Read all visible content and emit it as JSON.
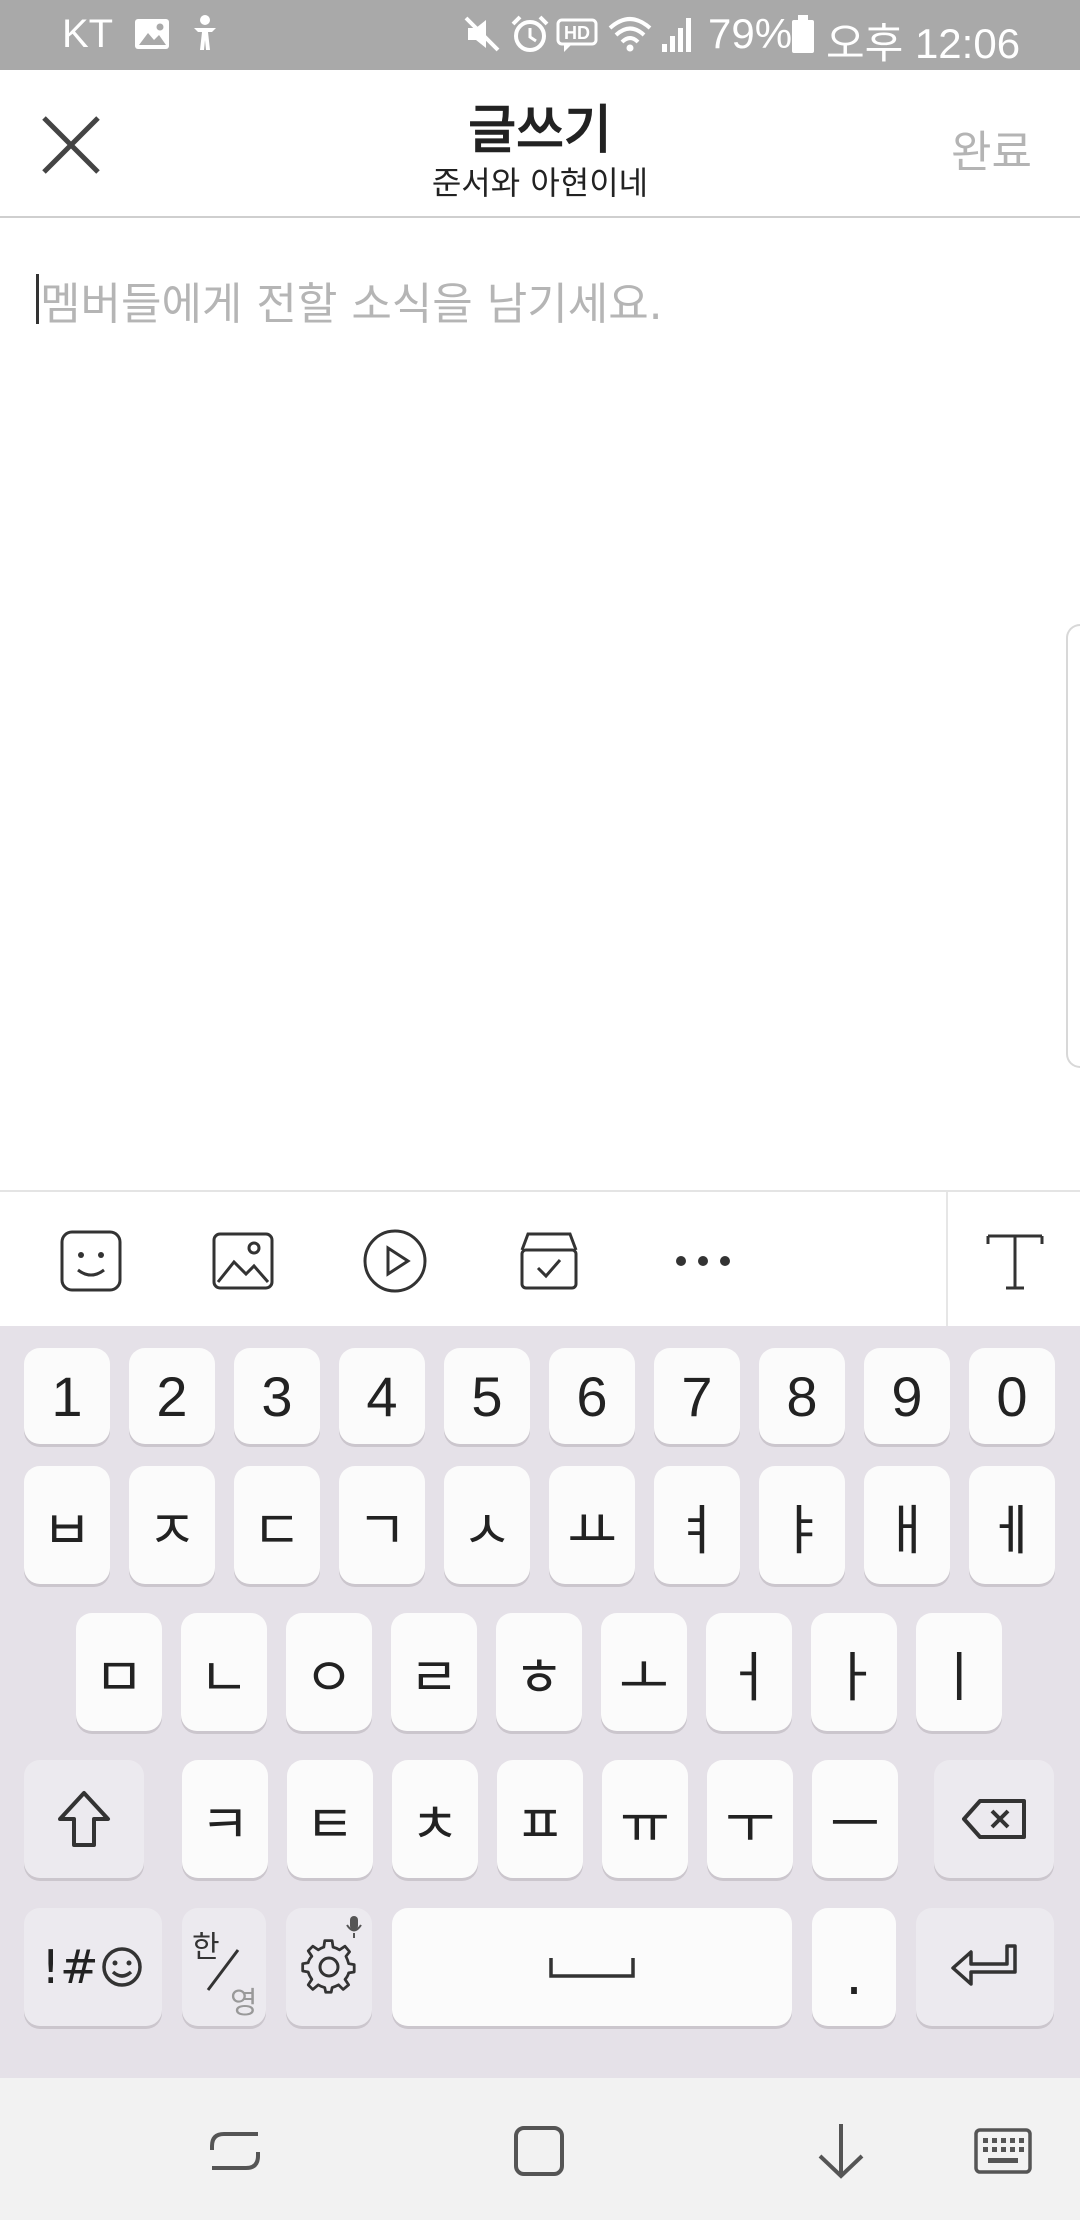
{
  "status_bar": {
    "carrier": "KT",
    "battery": "79%",
    "time": "오후 12:06",
    "icons": [
      "gallery-notification-icon",
      "accessibility-icon",
      "mute-icon",
      "alarm-icon",
      "hd-voice-icon",
      "wifi-icon",
      "signal-icon",
      "battery-icon"
    ]
  },
  "header": {
    "title": "글쓰기",
    "subtitle": "준서와 아현이네",
    "done_label": "완료",
    "close_icon": "close-icon"
  },
  "editor": {
    "placeholder": "멤버들에게 전할 소식을 남기세요."
  },
  "toolbar": {
    "icons": [
      "sticker-icon",
      "photo-icon",
      "video-icon",
      "vote-icon",
      "more-icon",
      "text-style-icon"
    ]
  },
  "keyboard": {
    "number_row": [
      "1",
      "2",
      "3",
      "4",
      "5",
      "6",
      "7",
      "8",
      "9",
      "0"
    ],
    "row1": [
      "ㅂ",
      "ㅈ",
      "ㄷ",
      "ㄱ",
      "ㅅ",
      "ㅛ",
      "ㅕ",
      "ㅑ",
      "ㅐ",
      "ㅔ"
    ],
    "row2": [
      "ㅁ",
      "ㄴ",
      "ㅇ",
      "ㄹ",
      "ㅎ",
      "ㅗ",
      "ㅓ",
      "ㅏ",
      "ㅣ"
    ],
    "row3": [
      "ㅋ",
      "ㅌ",
      "ㅊ",
      "ㅍ",
      "ㅠ",
      "ㅜ",
      "ㅡ"
    ],
    "symbols_label": "!#",
    "lang_top": "한",
    "lang_bottom": "영",
    "period_label": "."
  },
  "colors": {
    "status_bar_bg": "#a9a9a9",
    "keyboard_bg": "#e5e1e8",
    "done_disabled": "#b4b4b4",
    "placeholder": "#b5b5b5"
  }
}
